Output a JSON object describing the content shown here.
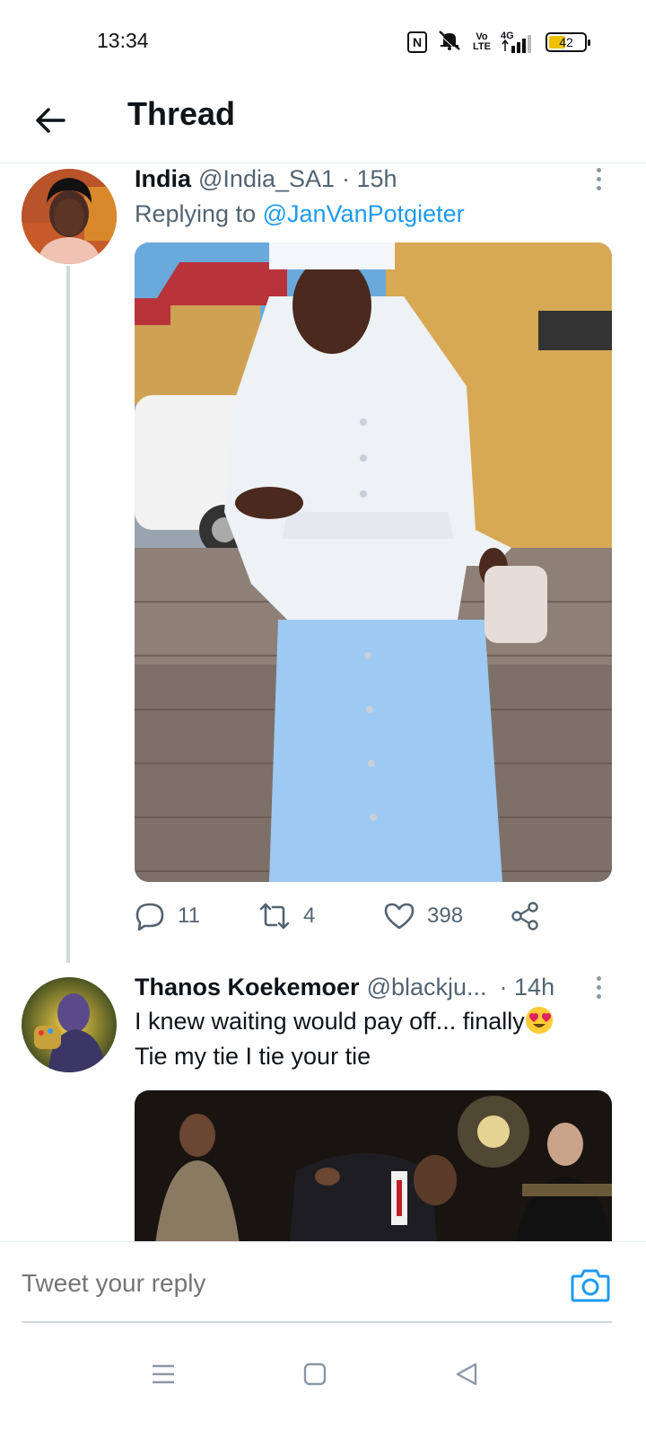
{
  "status_bar": {
    "time": "13:34",
    "icons": [
      "nfc-icon",
      "mute-icon",
      "volte-icon",
      "4g-signal-icon",
      "battery-icon"
    ],
    "nfc_label": "N",
    "volte_label": "Vo LTE",
    "network_label": "4G",
    "battery_level": "42"
  },
  "header": {
    "back_icon": "arrow-left-icon",
    "title": "Thread"
  },
  "tweets": [
    {
      "name": "India",
      "handle": "@India_SA1",
      "time": "· 15h",
      "replying_prefix": "Replying to",
      "replying_to": "@JanVanPotgieter",
      "replies": "11",
      "retweets": "4",
      "likes": "398"
    },
    {
      "name": "Thanos Koekemoer",
      "handle": "@blackju...",
      "time": "· 14h",
      "text_line1": "I knew waiting would pay off... finally",
      "emoji": "heart-eyes-emoji",
      "text_line2": "Tie my tie I tie your tie"
    }
  ],
  "reply_bar": {
    "placeholder": "Tweet your reply",
    "camera_icon": "camera-icon"
  },
  "nav_bar": {
    "icons": [
      "menu-icon",
      "home-square-icon",
      "back-triangle-icon"
    ]
  },
  "colors": {
    "accent": "#1d9bf0",
    "secondary_text": "#536471",
    "primary_text": "#0f1419",
    "thread_line": "#cfd9de"
  }
}
